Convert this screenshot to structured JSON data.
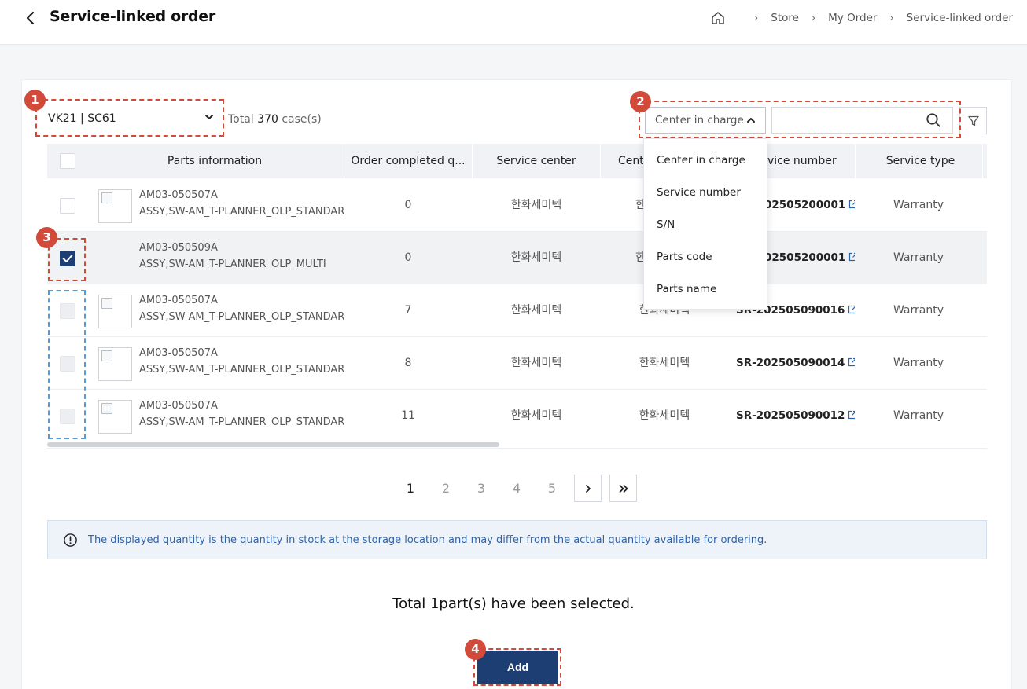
{
  "header": {
    "back_icon": "chevron-left-icon",
    "title": "Service-linked order",
    "breadcrumb": {
      "home_icon": "home-icon",
      "items": [
        "Store",
        "My Order",
        "Service-linked order"
      ]
    }
  },
  "toolbar": {
    "site_select_value": "VK21 | SC61",
    "total_prefix": "Total ",
    "total_count": "370",
    "total_suffix": " case(s)",
    "search_type_value": "Center in charge",
    "search_value": "",
    "search_icon": "search-icon",
    "filter_icon": "filter-icon"
  },
  "search_type_options": [
    "Center in charge",
    "Service number",
    "S/N",
    "Parts code",
    "Parts name"
  ],
  "table": {
    "columns": [
      "Parts information",
      "Order completed q...",
      "Service center",
      "Cent",
      "vice number",
      "Service type"
    ],
    "rows": [
      {
        "parts_code": "AM03-050507A",
        "parts_name": "ASSY,SW-AM_T-PLANNER_OLP_STANDARD",
        "qty": "0",
        "service_center": "한화세미텍",
        "center_in_charge": "한",
        "service_number": "02505200001",
        "service_type": "Warranty",
        "checkbox": "empty"
      },
      {
        "parts_code": "AM03-050509A",
        "parts_name": "ASSY,SW-AM_T-PLANNER_OLP_MULTI",
        "qty": "0",
        "service_center": "한화세미텍",
        "center_in_charge": "한",
        "service_number": "02505200001",
        "service_type": "Warranty",
        "checkbox": "checked"
      },
      {
        "parts_code": "AM03-050507A",
        "parts_name": "ASSY,SW-AM_T-PLANNER_OLP_STANDARD",
        "qty": "7",
        "service_center": "한화세미텍",
        "center_in_charge": "한화세미텍",
        "service_number": "SR-202505090016",
        "service_type": "Warranty",
        "checkbox": "disabled"
      },
      {
        "parts_code": "AM03-050507A",
        "parts_name": "ASSY,SW-AM_T-PLANNER_OLP_STANDARD",
        "qty": "8",
        "service_center": "한화세미텍",
        "center_in_charge": "한화세미텍",
        "service_number": "SR-202505090014",
        "service_type": "Warranty",
        "checkbox": "disabled"
      },
      {
        "parts_code": "AM03-050507A",
        "parts_name": "ASSY,SW-AM_T-PLANNER_OLP_STANDARD",
        "qty": "11",
        "service_center": "한화세미텍",
        "center_in_charge": "한화세미텍",
        "service_number": "SR-202505090012",
        "service_type": "Warranty",
        "checkbox": "disabled"
      }
    ]
  },
  "pagination": {
    "pages": [
      "1",
      "2",
      "3",
      "4",
      "5"
    ],
    "current": "1",
    "next_icon": "chevron-right-icon",
    "last_icon": "double-chevron-right-icon"
  },
  "notice": {
    "icon": "info-icon",
    "text": "The displayed quantity is the quantity in stock at the storage location and may differ from the actual quantity available for ordering."
  },
  "selection_summary": "Total 1part(s) have been selected.",
  "add_button_label": "Add",
  "annotations": [
    "1",
    "2",
    "3",
    "4"
  ],
  "colors": {
    "primary": "#1d3e73",
    "annotation_red": "#d14a3a",
    "annotation_blue": "#5b9bd5",
    "notice_text": "#2f63a8"
  }
}
